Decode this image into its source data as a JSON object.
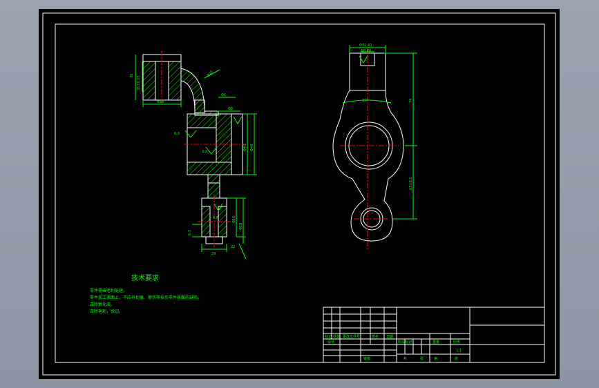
{
  "drawing": {
    "tech_requirements": {
      "title": "技术要求",
      "items": [
        "零件需去毛刺处理。",
        "零件加工表面上，不应有划痕、擦伤等损伤零件表面的缺陷。",
        "去除氧化皮。",
        "去除毛刺，锐边。"
      ]
    },
    "dimensions": {
      "front_top_width": "Φ16",
      "front_left_height": "35±0.05",
      "front_left_extent": "36",
      "front_radius": "R21",
      "front_neck": "Φ6",
      "front_boss": "Φ8",
      "front_bore": "Φ40",
      "front_outer": "Φ48",
      "front_bottom_width": "29",
      "front_bottom_h1": "Φ16",
      "front_bottom_h2": "Φ18",
      "front_bottom_small": "6.3",
      "front_bottom_step": "22",
      "roughness_a": "6.3",
      "roughness_b": "3.2",
      "roughness_c": "0.8",
      "side_top_w1": "Φ32.40",
      "side_top_w2": "Φ8.40",
      "side_angle": "15°",
      "side_height": "74",
      "side_lower": "63±0.1"
    },
    "title_block": {
      "label_mark": "标记",
      "label_count": "处数",
      "label_file": "更改文件号",
      "label_sign": "签名",
      "label_date": "日期",
      "label_design": "设计",
      "label_stage": "阶段标记",
      "label_weight": "重量",
      "label_scale": "比例",
      "scale_value": "1:1",
      "label_total": "共",
      "label_sheet": "张",
      "label_page": "第",
      "label_review": "审核"
    }
  },
  "colors": {
    "background": "#000000",
    "outline": "#ffffff",
    "dimension": "#00ff00",
    "hatch": "#00ff00",
    "centerline": "#ff0000",
    "text": "#00ff00",
    "window_bg": "#9aa3b2"
  }
}
